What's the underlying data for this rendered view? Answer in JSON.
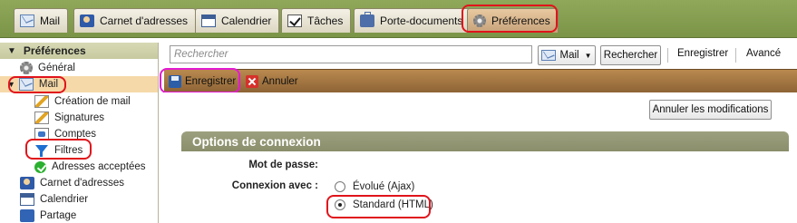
{
  "tabs": [
    {
      "label": "Mail",
      "icon": "mail-icon"
    },
    {
      "label": "Carnet d'adresses",
      "icon": "address-book-icon"
    },
    {
      "label": "Calendrier",
      "icon": "calendar-icon"
    },
    {
      "label": "Tâches",
      "icon": "tasks-icon"
    },
    {
      "label": "Porte-documents",
      "icon": "briefcase-icon"
    },
    {
      "label": "Préférences",
      "icon": "gear-icon",
      "active": true
    }
  ],
  "sidebar": {
    "header": "Préférences",
    "items": [
      {
        "label": "Général",
        "icon": "gear-icon"
      },
      {
        "label": "Mail",
        "icon": "mail-icon",
        "selected": true
      },
      {
        "label": "Création de mail",
        "icon": "compose-icon"
      },
      {
        "label": "Signatures",
        "icon": "signature-icon"
      },
      {
        "label": "Comptes",
        "icon": "accounts-icon"
      },
      {
        "label": "Filtres",
        "icon": "filter-icon"
      },
      {
        "label": "Adresses acceptées",
        "icon": "check-icon"
      },
      {
        "label": "Carnet d'adresses",
        "icon": "address-book-icon"
      },
      {
        "label": "Calendrier",
        "icon": "calendar-icon"
      },
      {
        "label": "Partage",
        "icon": "share-icon"
      }
    ]
  },
  "search": {
    "placeholder": "Rechercher",
    "scope": "Mail",
    "search_button": "Rechercher",
    "save_link": "Enregistrer",
    "advanced_link": "Avancé"
  },
  "toolbar": {
    "save": "Enregistrer",
    "cancel": "Annuler"
  },
  "content": {
    "undo_button": "Annuler les modifications",
    "section_title": "Options de connexion",
    "password_label": "Mot de passe:",
    "connect_label": "Connexion avec :",
    "options": [
      {
        "label": "Évolué (Ajax)",
        "checked": false
      },
      {
        "label": "Standard (HTML)",
        "checked": true
      }
    ]
  },
  "colors": {
    "highlight_red": "#e0141b",
    "highlight_magenta": "#e21bd0",
    "topbar": "#7b9447",
    "toolbar": "#9a6f3e"
  }
}
